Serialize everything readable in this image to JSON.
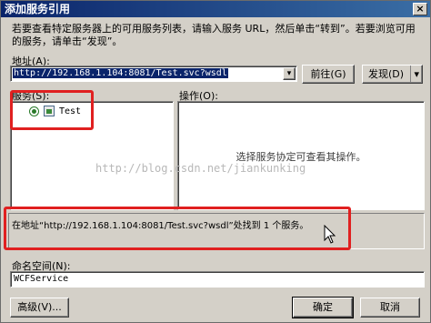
{
  "window": {
    "title": "添加服务引用",
    "close_glyph": "×"
  },
  "description": "若要查看特定服务器上的可用服务列表，请输入服务 URL，然后单击“转到”。若要浏览可用的服务，请单击“发现”。",
  "address": {
    "label": "地址(A):",
    "value": "http://192.168.1.104:8081/Test.svc?wsdl",
    "go_button": "前往(G)",
    "discover_button": "发现(D)",
    "dropdown_glyph": "▾"
  },
  "services": {
    "label": "服务(S):",
    "items": [
      {
        "name": "Test",
        "expanded": false
      }
    ]
  },
  "operations": {
    "label": "操作(O):",
    "placeholder": "选择服务协定可查看其操作。"
  },
  "status_message": "在地址“http://192.168.1.104:8081/Test.svc?wsdl”处找到 1 个服务。",
  "namespace": {
    "label": "命名空间(N):",
    "value": "WCFService"
  },
  "buttons": {
    "advanced": "高级(V)...",
    "ok": "确定",
    "cancel": "取消"
  },
  "watermark": "http://blog.csdn.net/jiankunking",
  "colors": {
    "titlebar": "#0a246a",
    "highlight": "#e02020"
  }
}
